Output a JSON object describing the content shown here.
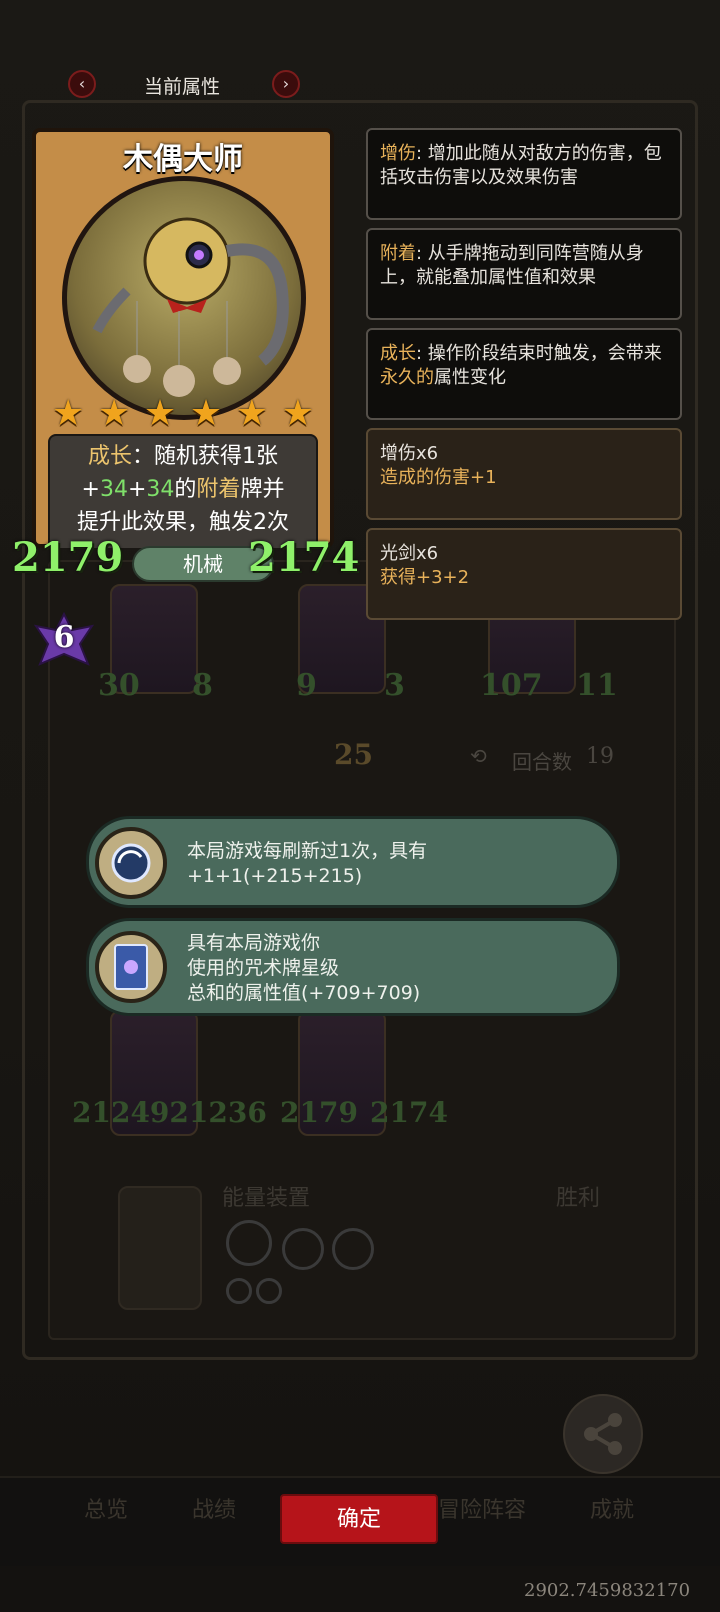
{
  "header": {
    "title": "当前属性"
  },
  "card": {
    "name": "木偶大师",
    "stars": 6,
    "desc_line1_kw": "成长",
    "desc_line1_rest": "：随机获得1张",
    "desc_line2_plus1": "+",
    "desc_line2_v1": "34",
    "desc_line2_plus2": "+",
    "desc_line2_v2": "34",
    "desc_line2_mid": "的",
    "desc_line2_kw": "附着",
    "desc_line2_rest": "牌并",
    "desc_line3": "提升此效果，触发2次",
    "attack": "2179",
    "health": "2174",
    "type": "机械",
    "tier": "6"
  },
  "tooltips": [
    {
      "kw": "增伤",
      "text": ": 增加此随从对敌方的伤害，包括攻击伤害以及效果伤害"
    },
    {
      "kw": "附着",
      "text": ": 从手牌拖动到同阵营随从身上，就能叠加属性值和效果"
    },
    {
      "kw": "成长",
      "text_a": ": 操作阶段结束时触发，会带来",
      "kw2": "永久的",
      "text_b": "属性变化"
    }
  ],
  "buffs": [
    {
      "name": "增伤x6",
      "effect": "造成的伤害+1"
    },
    {
      "name": "光剑x6",
      "effect": "获得+3+2"
    }
  ],
  "effects": [
    {
      "line1": "本局游戏每刷新过1次，具有",
      "line2": "+1+1(+215+215)"
    },
    {
      "line1": "具有本局游戏你",
      "line2": "使用的咒术牌星级",
      "line3": "总和的属性值(+709+709)"
    }
  ],
  "board": {
    "minions_top": [
      {
        "atk": "30",
        "hp": "8"
      },
      {
        "atk": "9",
        "hp": "3"
      },
      {
        "atk": "107",
        "hp": "11"
      }
    ],
    "level": "25",
    "round_label": "回合数",
    "round_value": "19",
    "minions_bottom_text_a": "2124921236",
    "minions_bottom_b_atk": "2179",
    "minions_bottom_b_hp": "2174",
    "energy_label": "能量装置",
    "result_label": "胜利"
  },
  "bottom_nav": {
    "tabs": [
      "总览",
      "战绩",
      "冒险阵容",
      "成就"
    ],
    "confirm": "确定",
    "share": "分享"
  },
  "footer": {
    "id": "2902.7459832170"
  },
  "colors": {
    "accent_red": "#b6141a",
    "keyword_gold": "#e8b25a",
    "stat_green": "#8ff06a"
  }
}
